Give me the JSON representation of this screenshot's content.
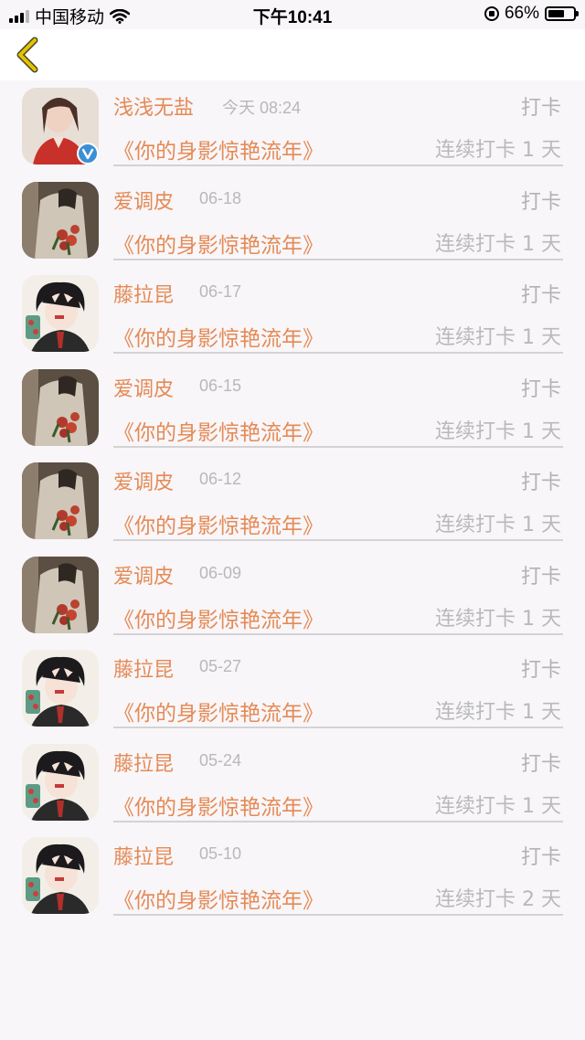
{
  "status_bar": {
    "carrier": "中国移动",
    "time": "下午10:41",
    "battery_percent": "66%",
    "battery_level": 0.66
  },
  "nav": {
    "back_icon": "chevron-left-icon",
    "accent_color": "#e6c300"
  },
  "rows": [
    {
      "name": "浅浅无盐",
      "date": "今天 08:24",
      "action": "打卡",
      "book": "《你的身影惊艳流年》",
      "streak": "连续打卡 1 天",
      "avatar": "fan",
      "verified": true
    },
    {
      "name": "爱调皮",
      "date": "06-18",
      "action": "打卡",
      "book": "《你的身影惊艳流年》",
      "streak": "连续打卡 1 天",
      "avatar": "flower",
      "verified": false
    },
    {
      "name": "藤拉昆",
      "date": "06-17",
      "action": "打卡",
      "book": "《你的身影惊艳流年》",
      "streak": "连续打卡 1 天",
      "avatar": "anime",
      "verified": false
    },
    {
      "name": "爱调皮",
      "date": "06-15",
      "action": "打卡",
      "book": "《你的身影惊艳流年》",
      "streak": "连续打卡 1 天",
      "avatar": "flower",
      "verified": false
    },
    {
      "name": "爱调皮",
      "date": "06-12",
      "action": "打卡",
      "book": "《你的身影惊艳流年》",
      "streak": "连续打卡 1 天",
      "avatar": "flower",
      "verified": false
    },
    {
      "name": "爱调皮",
      "date": "06-09",
      "action": "打卡",
      "book": "《你的身影惊艳流年》",
      "streak": "连续打卡 1 天",
      "avatar": "flower",
      "verified": false
    },
    {
      "name": "藤拉昆",
      "date": "05-27",
      "action": "打卡",
      "book": "《你的身影惊艳流年》",
      "streak": "连续打卡 1 天",
      "avatar": "anime",
      "verified": false
    },
    {
      "name": "藤拉昆",
      "date": "05-24",
      "action": "打卡",
      "book": "《你的身影惊艳流年》",
      "streak": "连续打卡 1 天",
      "avatar": "anime",
      "verified": false
    },
    {
      "name": "藤拉昆",
      "date": "05-10",
      "action": "打卡",
      "book": "《你的身影惊艳流年》",
      "streak": "连续打卡 2 天",
      "avatar": "anime",
      "verified": false
    }
  ],
  "colors": {
    "name": "#e58a55",
    "muted": "#b8b8b8",
    "background": "#f8f6f9"
  }
}
